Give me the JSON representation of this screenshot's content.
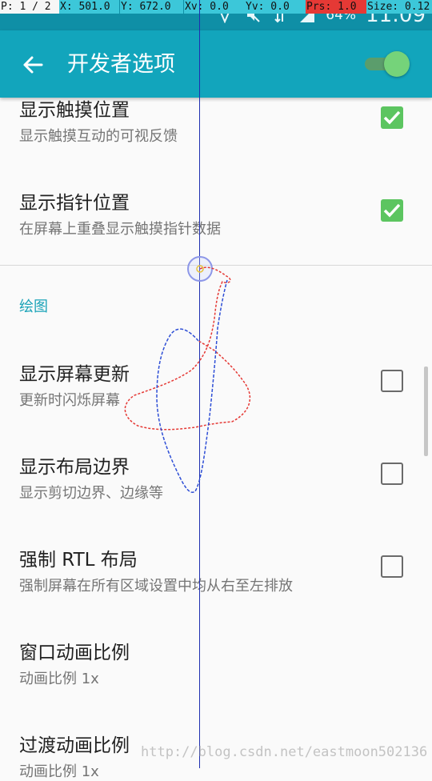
{
  "debug_bar": {
    "pointers": "P: 1 / 2",
    "x": "X: 501.0",
    "y": "Y: 672.0",
    "xv": "Xv: 0.0",
    "yv": "Yv: 0.0",
    "prs": "Prs: 1.0",
    "size": "Size: 0.12"
  },
  "status_bar": {
    "battery": "64%",
    "time": "11:09",
    "icons": [
      "notification-icon",
      "mute-icon",
      "data-icon",
      "signal-icon"
    ]
  },
  "app_bar": {
    "title": "开发者选项",
    "master_switch_on": true
  },
  "preferences": [
    {
      "title": "显示触摸位置",
      "summary": "显示触摸互动的可视反馈",
      "checked": true
    },
    {
      "title": "显示指针位置",
      "summary": "在屏幕上重叠显示触摸指针数据",
      "checked": true
    },
    {
      "title": "显示屏幕更新",
      "summary": "更新时闪烁屏幕",
      "checked": false
    },
    {
      "title": "显示布局边界",
      "summary": "显示剪切边界、边缘等",
      "checked": false
    },
    {
      "title": "强制 RTL 布局",
      "summary": "强制屏幕在所有区域设置中均从右至左排放",
      "checked": false
    },
    {
      "title": "窗口动画比例",
      "summary": "动画比例 1x"
    },
    {
      "title": "过渡动画比例",
      "summary": "动画比例 1x"
    }
  ],
  "section_header": "绘图",
  "watermark": "http://blog.csdn.net/eastmoon502136",
  "colors": {
    "app_bar": "#12a5bc",
    "status_bar": "#0f8fa6",
    "accent": "#5cc560",
    "section_header": "#1aa3b8",
    "debug_red": "#e53935",
    "debug_cyan": "#35c3d8"
  }
}
